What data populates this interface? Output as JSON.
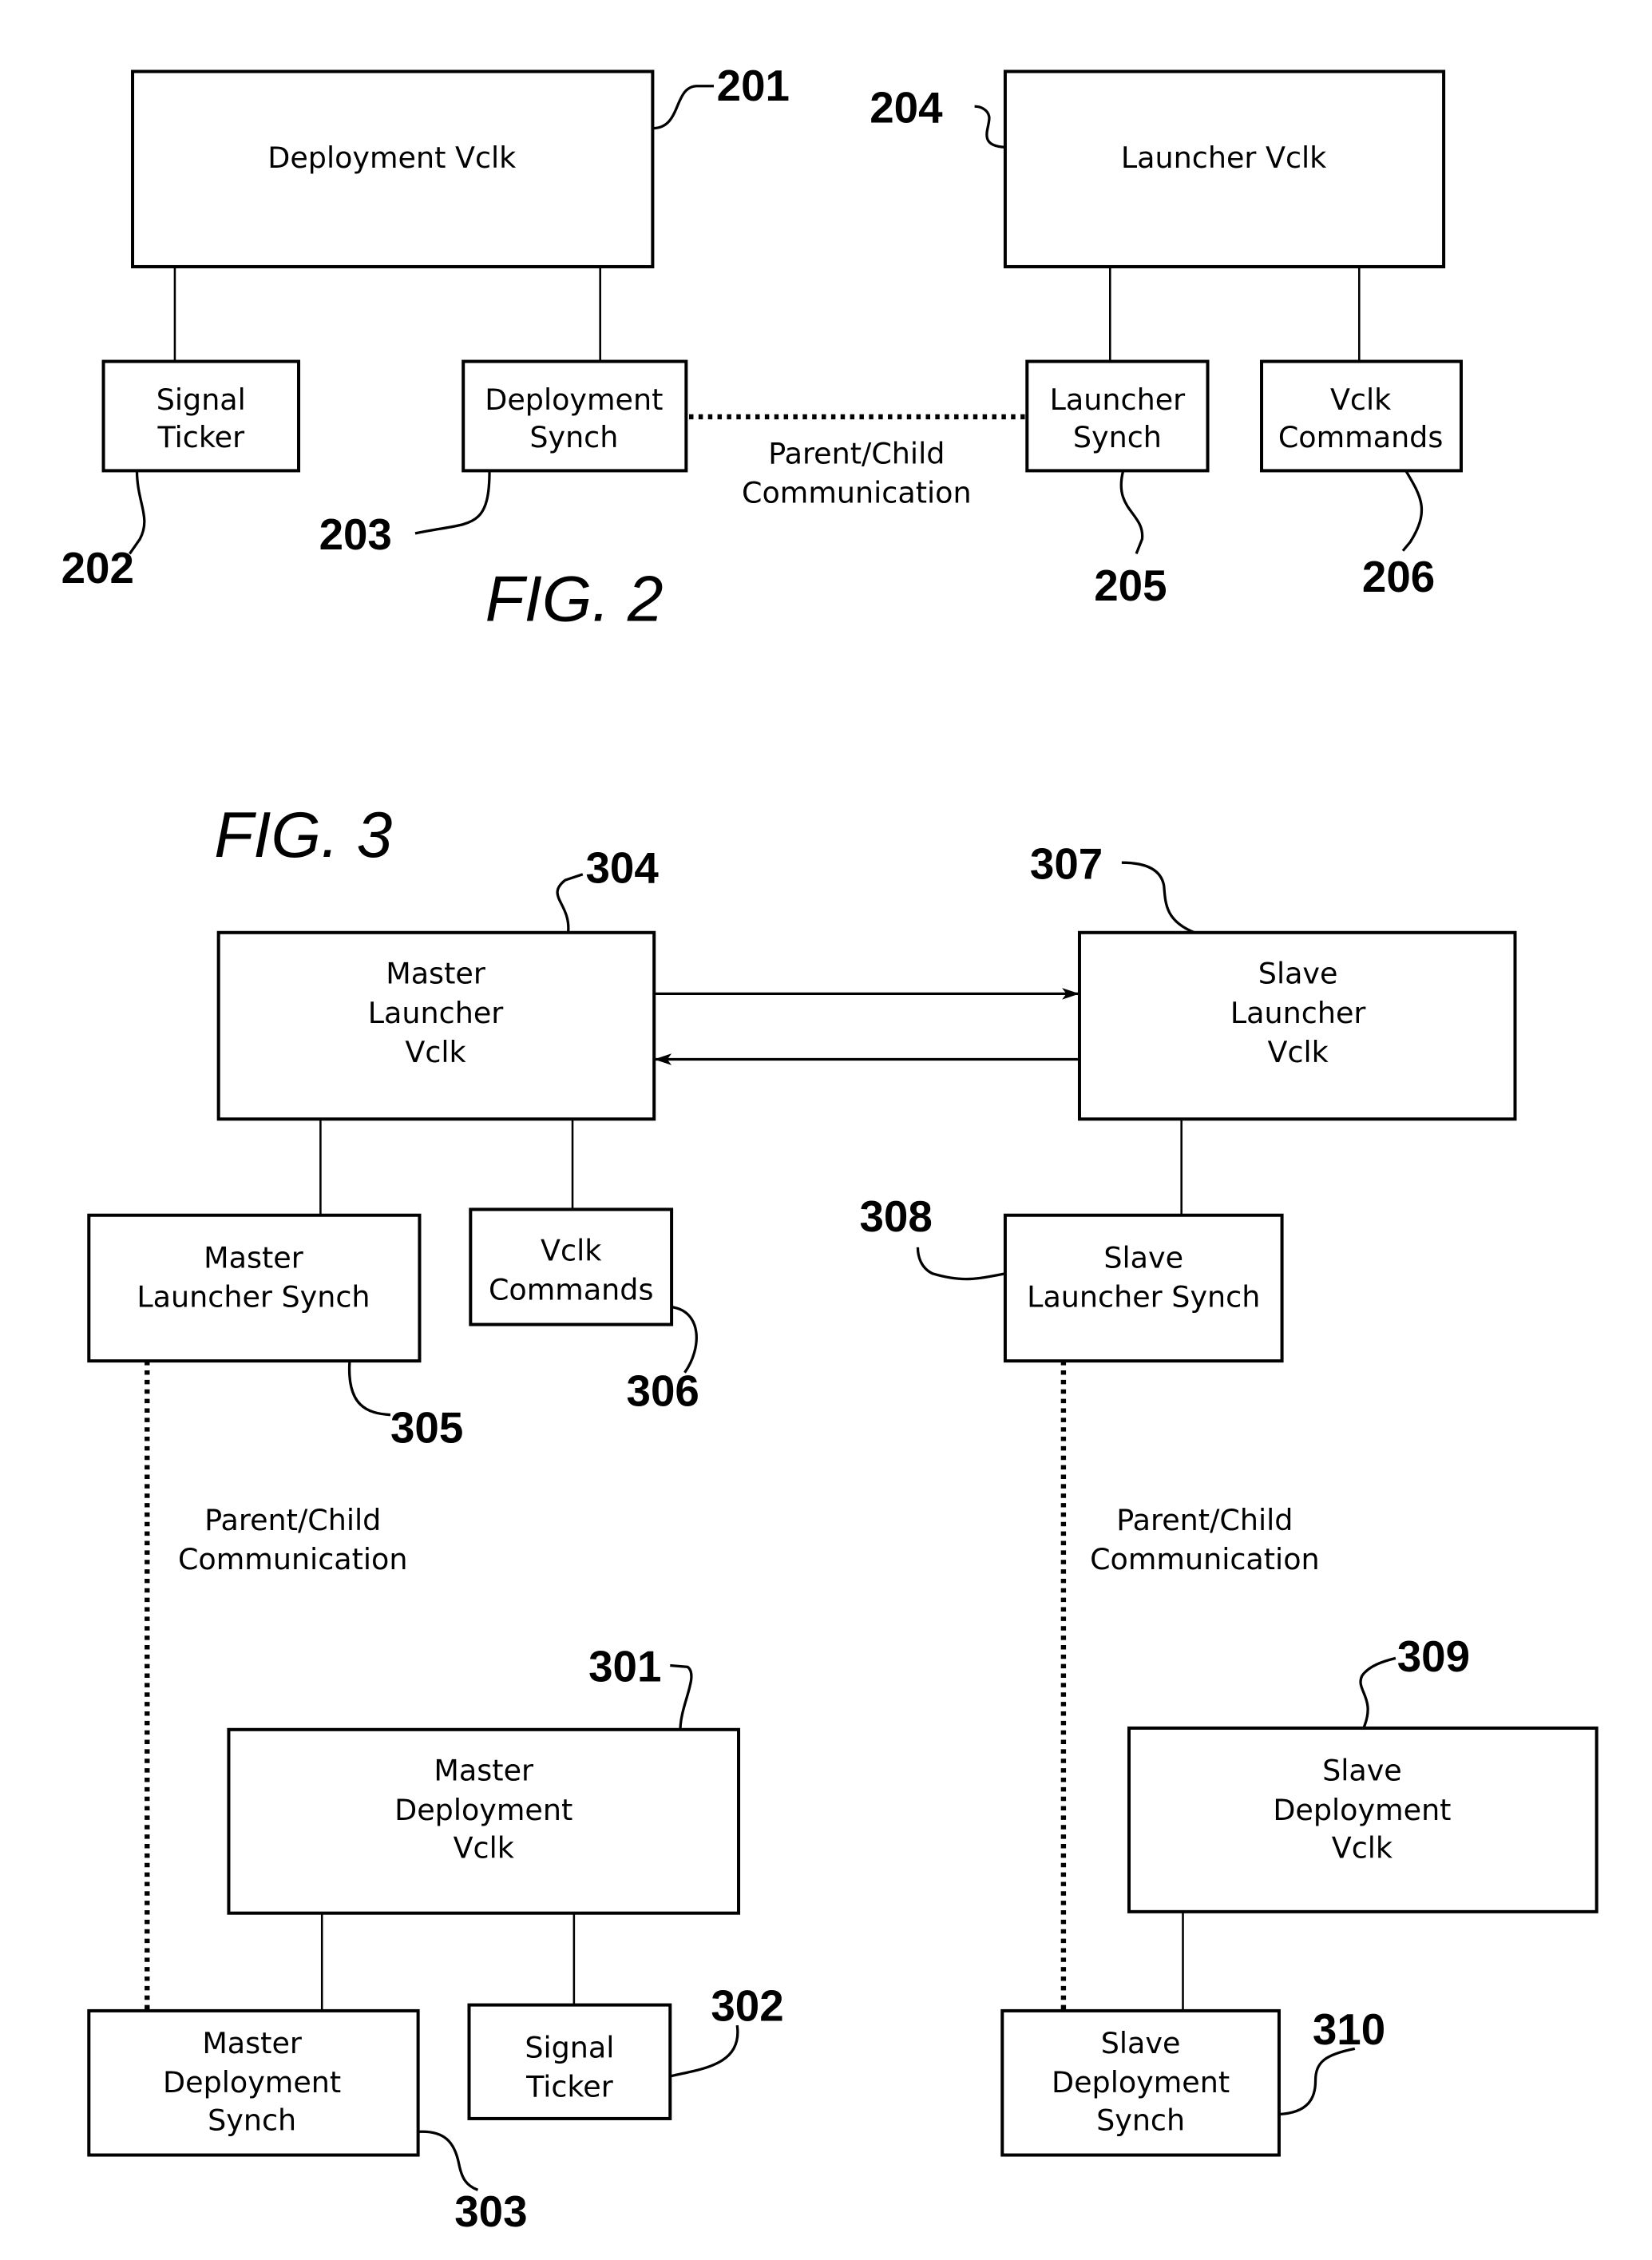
{
  "fig2": {
    "title": "FIG.  2",
    "blocks": {
      "deployment_vclk": {
        "lines": [
          "Deployment Vclk"
        ],
        "ref": "201"
      },
      "signal_ticker": {
        "lines": [
          "Signal",
          "Ticker"
        ],
        "ref": "202"
      },
      "deployment_synch": {
        "lines": [
          "Deployment",
          "Synch"
        ],
        "ref": "203"
      },
      "launcher_vclk": {
        "lines": [
          "Launcher Vclk"
        ],
        "ref": "204"
      },
      "launcher_synch": {
        "lines": [
          "Launcher",
          "Synch"
        ],
        "ref": "205"
      },
      "vclk_commands": {
        "lines": [
          "Vclk",
          "Commands"
        ],
        "ref": "206"
      }
    },
    "link_label": [
      "Parent/Child",
      "Communication"
    ]
  },
  "fig3": {
    "title": "FIG.  3",
    "blocks": {
      "master_deployment_vclk": {
        "lines": [
          "Master",
          "Deployment",
          "Vclk"
        ],
        "ref": "301"
      },
      "signal_ticker": {
        "lines": [
          "Signal",
          "Ticker"
        ],
        "ref": "302"
      },
      "master_deployment_synch": {
        "lines": [
          "Master",
          "Deployment",
          "Synch"
        ],
        "ref": "303"
      },
      "master_launcher_vclk": {
        "lines": [
          "Master",
          "Launcher",
          "Vclk"
        ],
        "ref": "304"
      },
      "master_launcher_synch": {
        "lines": [
          "Master",
          "Launcher Synch"
        ],
        "ref": "305"
      },
      "vclk_commands": {
        "lines": [
          "Vclk",
          "Commands"
        ],
        "ref": "306"
      },
      "slave_launcher_vclk": {
        "lines": [
          "Slave",
          "Launcher",
          "Vclk"
        ],
        "ref": "307"
      },
      "slave_launcher_synch": {
        "lines": [
          "Slave",
          "Launcher Synch"
        ],
        "ref": "308"
      },
      "slave_deployment_vclk": {
        "lines": [
          "Slave",
          "Deployment",
          "Vclk"
        ],
        "ref": "309"
      },
      "slave_deployment_synch": {
        "lines": [
          "Slave",
          "Deployment",
          "Synch"
        ],
        "ref": "310"
      }
    },
    "link_label_left": [
      "Parent/Child",
      "Communication"
    ],
    "link_label_right": [
      "Parent/Child",
      "Communication"
    ]
  }
}
